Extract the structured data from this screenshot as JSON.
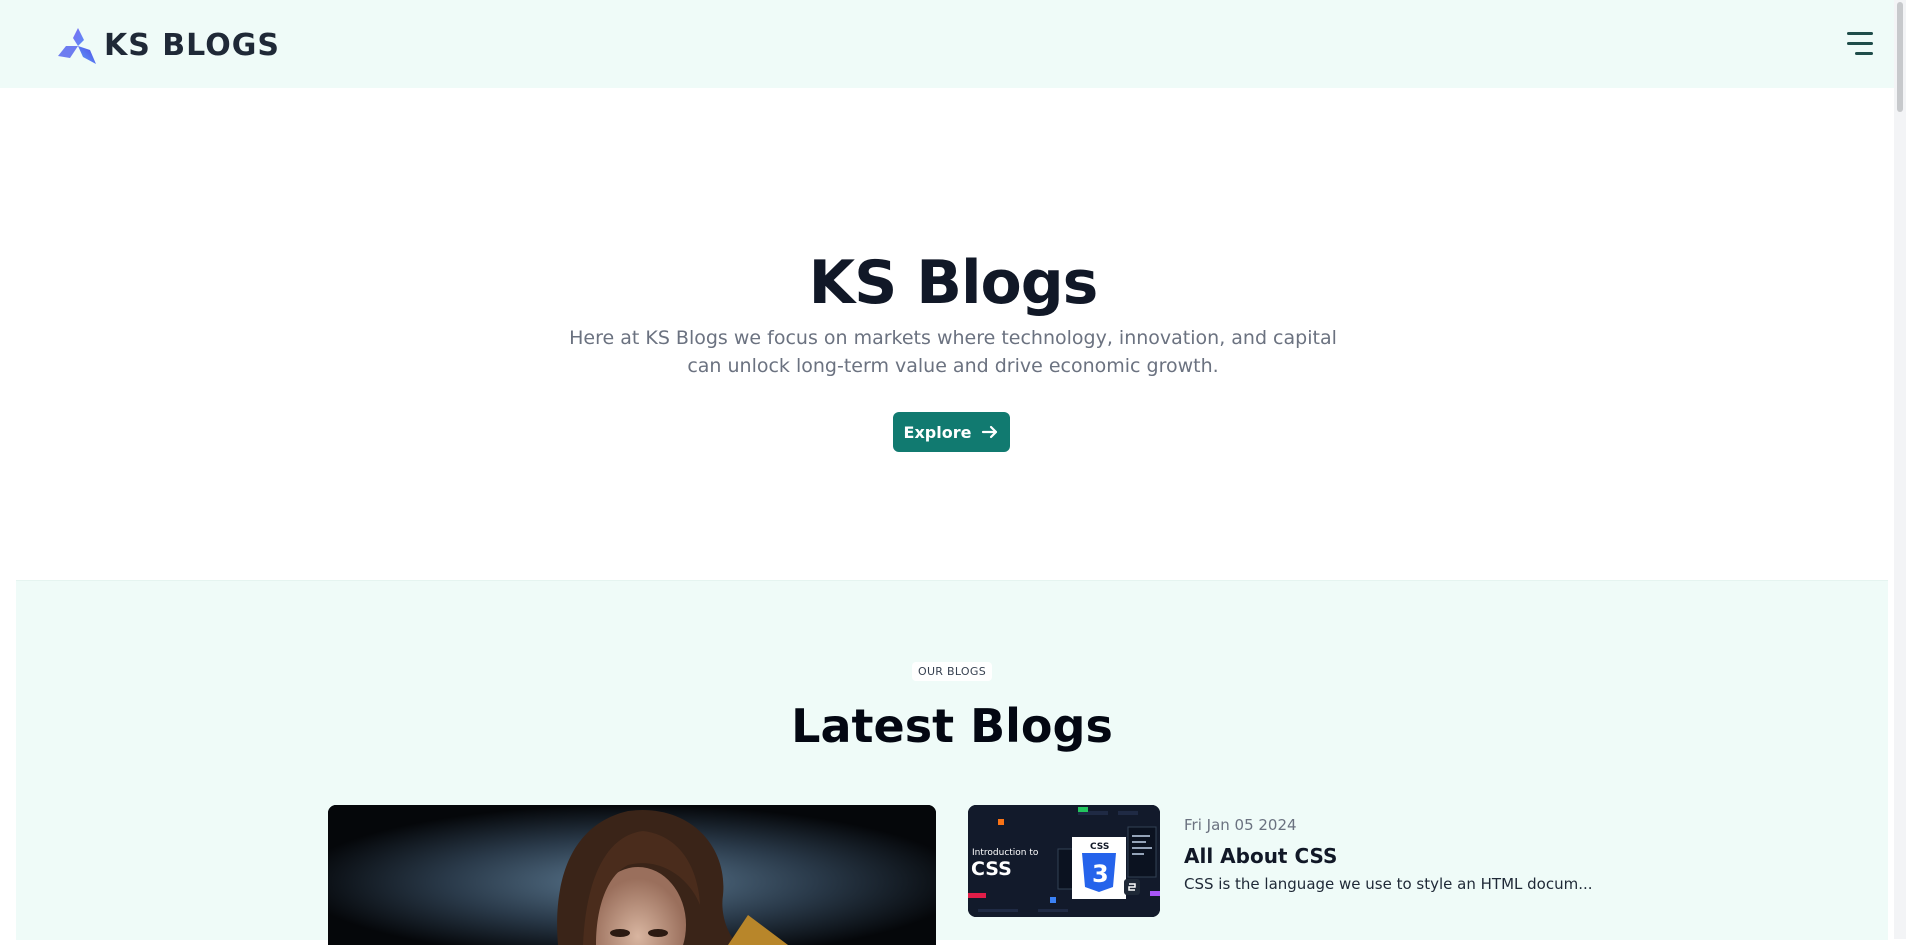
{
  "header": {
    "brand": "KS BLOGS",
    "menu_icon": "hamburger-menu-icon",
    "logo_icon": "triskele-logo-icon"
  },
  "hero": {
    "title": "KS Blogs",
    "description": "Here at KS Blogs we focus on markets where technology, innovation, and capital can unlock long-term value and drive economic growth.",
    "cta_label": "Explore",
    "cta_icon": "arrow-right-icon"
  },
  "blogs": {
    "eyebrow": "OUR BLOGS",
    "title": "Latest Blogs",
    "posts": [
      {
        "date": "Fri Jan 05 2024",
        "title": "All About CSS",
        "excerpt": "CSS is the language we use to style an HTML docum...",
        "thumb": {
          "intro_text": "Introduction to",
          "big_text": "CSS",
          "badge_text": "CSS",
          "shield_num": "3"
        }
      }
    ]
  },
  "colors": {
    "header_bg": "#effbf8",
    "accent": "#117a70",
    "section_bg": "#effbf8"
  }
}
